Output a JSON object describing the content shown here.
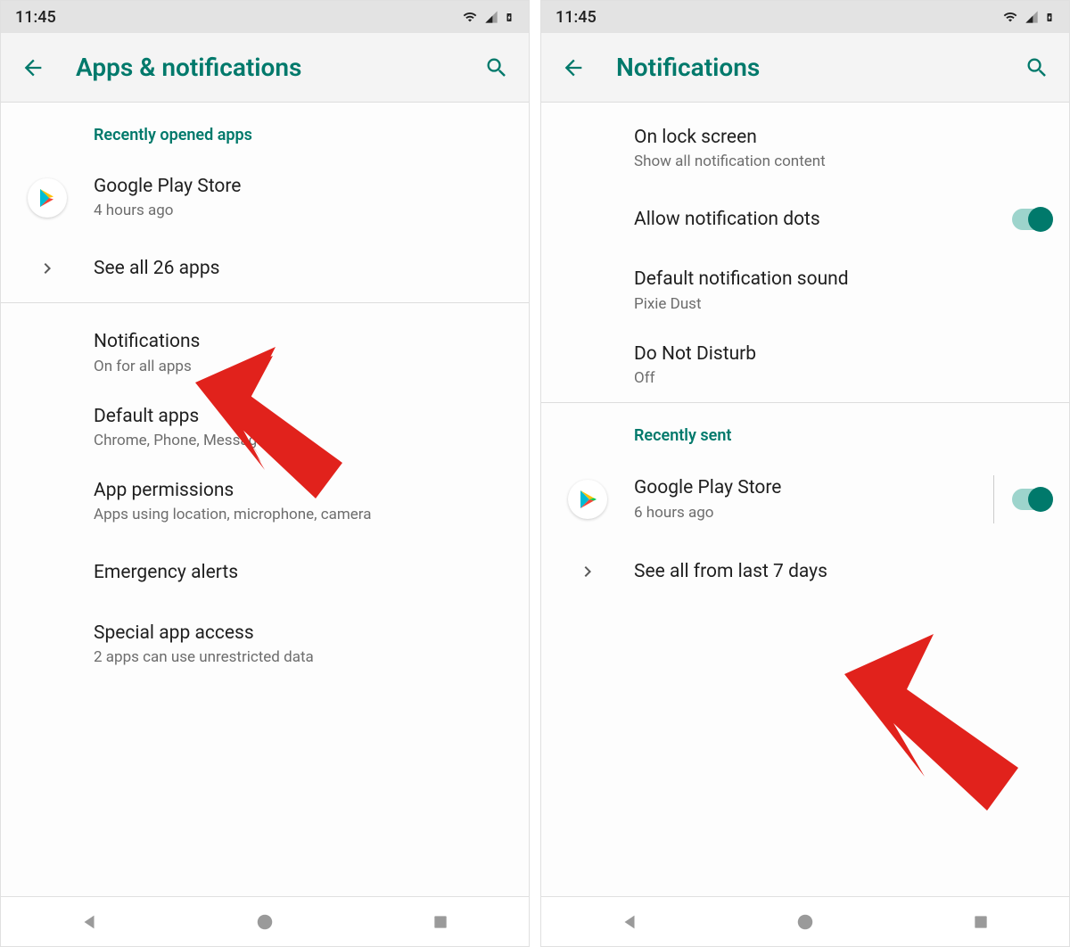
{
  "status": {
    "time": "11:45"
  },
  "left": {
    "title": "Apps & notifications",
    "section1_header": "Recently opened apps",
    "recent_app": {
      "name": "Google Play Store",
      "sub": "4 hours ago"
    },
    "see_all": "See all 26 apps",
    "items": [
      {
        "title": "Notifications",
        "sub": "On for all apps"
      },
      {
        "title": "Default apps",
        "sub": "Chrome, Phone, Messages"
      },
      {
        "title": "App permissions",
        "sub": "Apps using location, microphone, camera"
      },
      {
        "title": "Emergency alerts",
        "sub": ""
      },
      {
        "title": "Special app access",
        "sub": "2 apps can use unrestricted data"
      }
    ]
  },
  "right": {
    "title": "Notifications",
    "items": [
      {
        "title": "On lock screen",
        "sub": "Show all notification content"
      },
      {
        "title": "Allow notification dots",
        "sub": ""
      },
      {
        "title": "Default notification sound",
        "sub": "Pixie Dust"
      },
      {
        "title": "Do Not Disturb",
        "sub": "Off"
      }
    ],
    "section_header": "Recently sent",
    "recent_app": {
      "name": "Google Play Store",
      "sub": "6 hours ago"
    },
    "see_all": "See all from last 7 days"
  }
}
